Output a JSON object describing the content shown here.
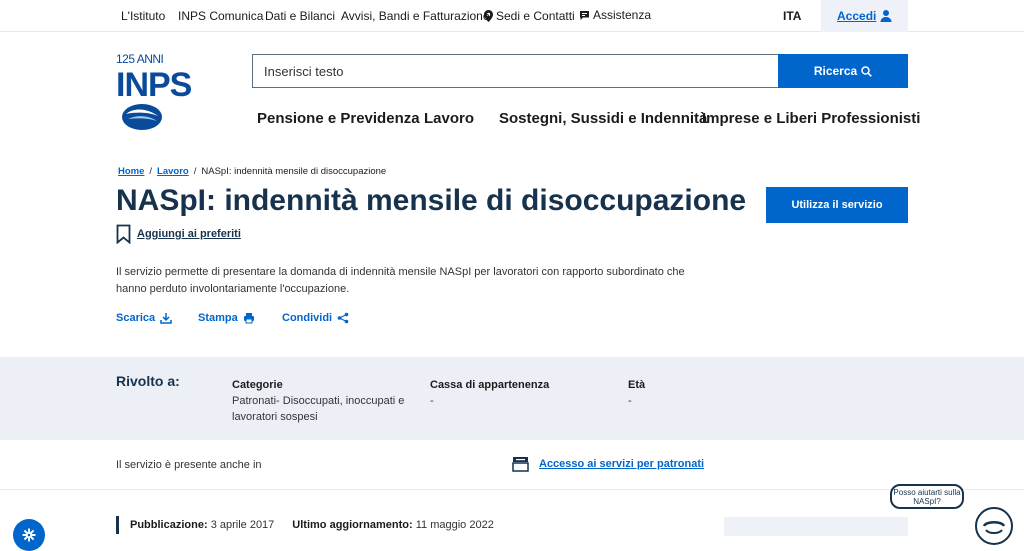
{
  "topbar": {
    "items": [
      "L'Istituto",
      "INPS Comunica",
      "Dati e Bilanci",
      "Avvisi, Bandi e Fatturazione",
      "Sedi e Contatti",
      "Assistenza"
    ],
    "language": "ITA",
    "login": "Accedi"
  },
  "logo": {
    "anniversary": "125 ANNI",
    "brand": "INPS"
  },
  "search": {
    "placeholder": "Inserisci testo",
    "button": "Ricerca"
  },
  "mainnav": [
    "Pensione e Previdenza",
    "Lavoro",
    "Sostegni, Sussidi e Indennità",
    "Imprese e Liberi Professionisti"
  ],
  "breadcrumb": {
    "home": "Home",
    "section": "Lavoro",
    "current": "NASpI: indennità mensile di disoccupazione"
  },
  "page": {
    "title": "NASpI: indennità mensile di disoccupazione",
    "favorite": "Aggiungi ai preferiti",
    "use_service": "Utilizza il servizio",
    "description": "Il servizio permette di presentare la domanda di indennità mensile NASpI per lavoratori con rapporto subordinato che hanno perduto involontariamente l'occupazione."
  },
  "actions": {
    "download": "Scarica",
    "print": "Stampa",
    "share": "Condividi"
  },
  "rivolto": {
    "heading": "Rivolto a:",
    "categorie_label": "Categorie",
    "categorie_value": "Patronati- Disoccupati, inoccupati e lavoratori sospesi",
    "cassa_label": "Cassa di appartenenza",
    "cassa_value": "-",
    "eta_label": "Età",
    "eta_value": "-"
  },
  "presente": {
    "text": "Il servizio è presente anche in",
    "link": "Accesso ai servizi per patronati"
  },
  "pubblicazione": {
    "label": "Pubblicazione:",
    "date": "3 aprile 2017",
    "update_label": "Ultimo aggiornamento:",
    "update_date": "11 maggio 2022"
  },
  "chat": {
    "bubble": "Posso aiutarti sulla NASpI?"
  },
  "colors": {
    "primary": "#0066cc",
    "dark": "#17324d",
    "band": "#ecf0f6"
  }
}
